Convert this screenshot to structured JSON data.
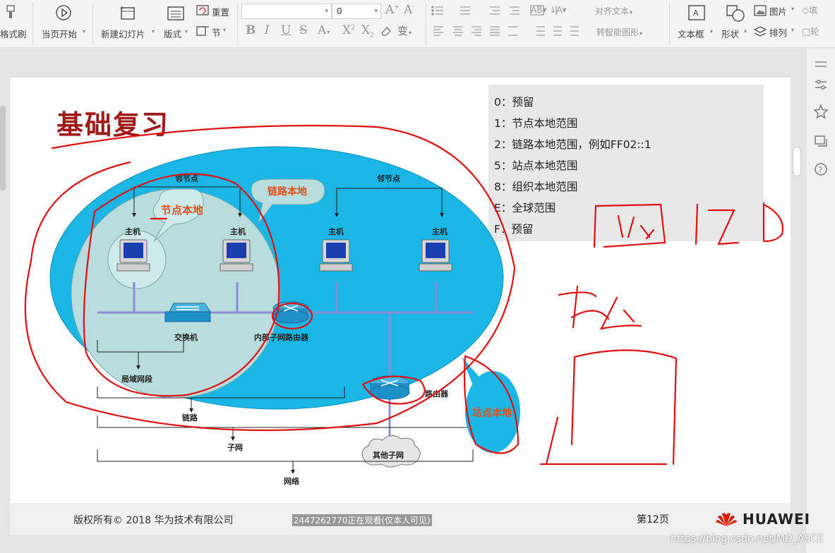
{
  "ribbon": {
    "format_painter": "格式刷",
    "home_start": "当页开始",
    "new_slide": "新建幻灯片",
    "layout": "版式",
    "reset": "重置",
    "section": "节",
    "font_size": "0",
    "align_text": "对齐文本",
    "convert_smartart": "转智能图形",
    "textbox": "文本框",
    "shape": "形状",
    "picture": "图片",
    "arrange": "排列",
    "fill_cut": "填",
    "outline_cut": "轮"
  },
  "slide": {
    "title": "基础复习",
    "scopes": [
      "0：预留",
      "1：节点本地范围",
      "2：链路本地范围，例如FF02::1",
      "5：站点本地范围",
      "8：组织本地范围",
      "E：全球范围",
      "F：预留"
    ],
    "diagram": {
      "neighbor_left": "邻节点",
      "neighbor_right": "邻节点",
      "host": "主机",
      "switch": "交换机",
      "internal_router": "内部子网路由器",
      "router": "路由器",
      "lan_segment": "局域网段",
      "link": "链路",
      "subnet": "子网",
      "network": "网络",
      "other_subnet": "其他子网",
      "callout_node_local": "节点本地",
      "callout_link_local": "链路本地",
      "callout_site_local": "站点本地"
    }
  },
  "footer": {
    "copyright": "版权所有© 2018 华为技术有限公司",
    "viewer": "2447262770正在观看(仅本人可见)",
    "page": "第12页",
    "brand": "HUAWEI"
  },
  "watermark": "https://blog.csdn.net/MD_ASCE",
  "colors": {
    "title_red": "#a01a1a",
    "ellipse_blue": "#19b6e6",
    "inner_circle": "#b9dcdc",
    "annotation_red": "#e01010",
    "link_line": "#8b8bd8"
  }
}
